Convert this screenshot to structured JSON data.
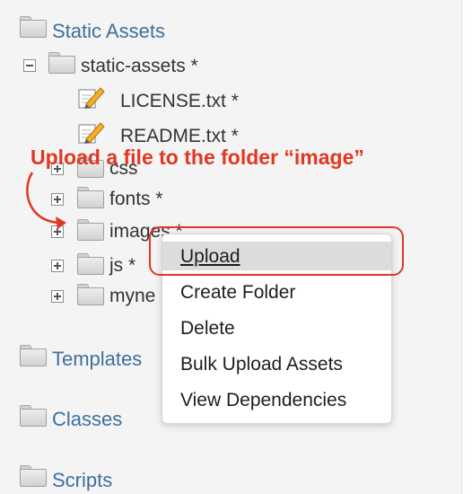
{
  "tree": {
    "sections": {
      "static_assets": "Static Assets",
      "templates": "Templates",
      "classes": "Classes",
      "scripts": "Scripts"
    },
    "root_folder": "static-assets *",
    "files": [
      "LICENSE.txt *",
      "README.txt *"
    ],
    "folders": [
      "css",
      "fonts *",
      "images *",
      "js *",
      "myne"
    ]
  },
  "annotation": {
    "text": "Upload a file to the folder “image”",
    "color": "#e03822"
  },
  "context_menu": {
    "items": [
      "Upload",
      "Create Folder",
      "Delete",
      "Bulk Upload Assets",
      "View Dependencies"
    ],
    "highlighted": "Upload"
  },
  "colors": {
    "section_link": "#3f6f9e",
    "annotation": "#e03822"
  }
}
